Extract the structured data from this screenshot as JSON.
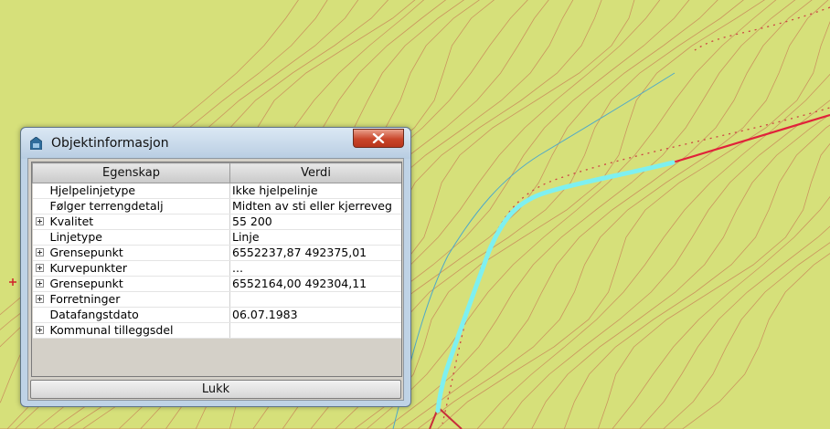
{
  "dialog": {
    "title": "Objektinformasjon",
    "close_icon": "close-x-icon",
    "columns": [
      "Egenskap",
      "Verdi"
    ],
    "rows": [
      {
        "name": "Hjelpelinjetype",
        "value": "Ikke hjelpelinje",
        "expandable": false
      },
      {
        "name": "Følger terrengdetalj",
        "value": "Midten av sti eller kjerreveg",
        "expandable": false
      },
      {
        "name": "Kvalitet",
        "value": "55  200",
        "expandable": true
      },
      {
        "name": "Linjetype",
        "value": "Linje",
        "expandable": false
      },
      {
        "name": "Grensepunkt",
        "value": "6552237,87 492375,01",
        "expandable": true
      },
      {
        "name": "Kurvepunkter",
        "value": "...",
        "expandable": true
      },
      {
        "name": "Grensepunkt",
        "value": "6552164,00 492304,11",
        "expandable": true
      },
      {
        "name": "Forretninger",
        "value": "",
        "expandable": true
      },
      {
        "name": "Datafangstdato",
        "value": "06.07.1983",
        "expandable": false
      },
      {
        "name": "Kommunal tilleggsdel",
        "value": "",
        "expandable": true
      }
    ],
    "close_button_label": "Lukk"
  },
  "map": {
    "background_color": "#d6e07a",
    "contour_color": "#c9885a",
    "boundary_color": "#e0223a",
    "highlight_color": "#7ef0f0",
    "stream_color": "#4fa9c8"
  }
}
